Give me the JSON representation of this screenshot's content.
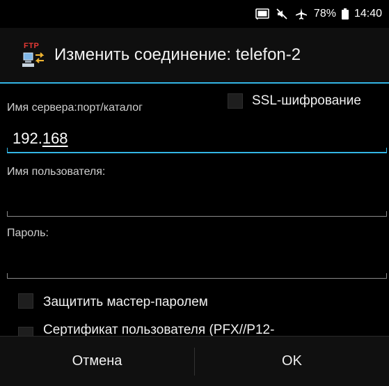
{
  "status_bar": {
    "battery": "78%",
    "time": "14:40",
    "icons": [
      "cast-icon",
      "mute-icon",
      "airplane-icon",
      "battery-icon"
    ]
  },
  "dialog": {
    "title": "Изменить соединение: telefon-2",
    "icon_text": "FTP",
    "server_label": "Имя сервера:порт/каталог",
    "ssl_label": "SSL-шифрование",
    "ssl_checked": false,
    "server_value_plain": "192.",
    "server_value_underlined": "168",
    "username_label": "Имя пользователя:",
    "username_value": "",
    "password_label": "Пароль:",
    "password_value": "",
    "master_password_label": "Защитить мастер-паролем",
    "master_password_checked": false,
    "certificate_label": "Сертификат пользователя (PFX//P12-",
    "certificate_checked": false
  },
  "buttons": {
    "cancel": "Отмена",
    "ok": "OK"
  },
  "colors": {
    "accent": "#33b5e5",
    "background": "#000000"
  }
}
